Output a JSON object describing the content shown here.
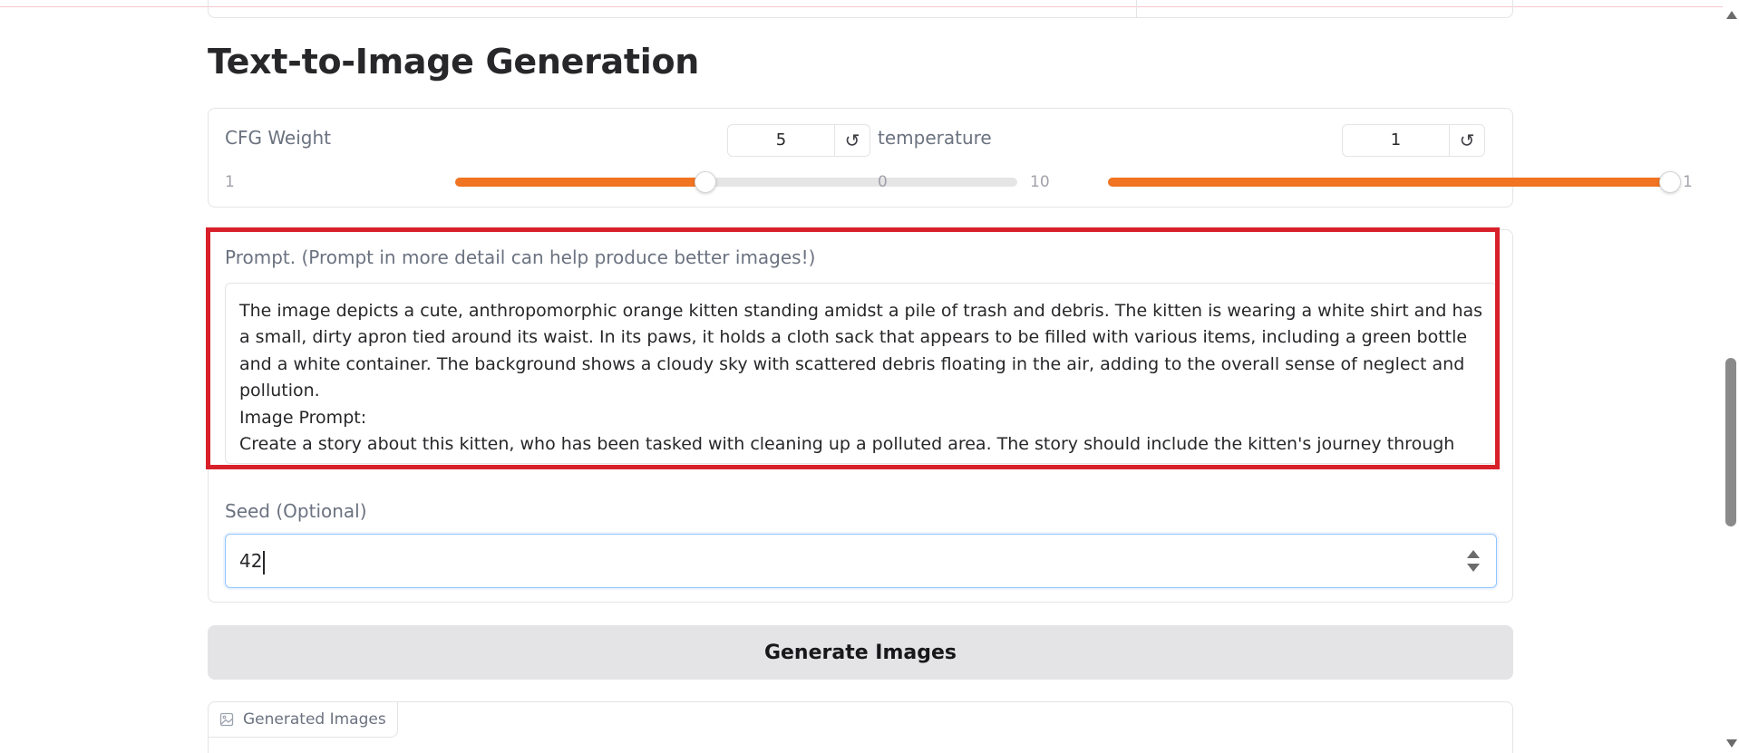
{
  "section": {
    "title": "Text-to-Image Generation"
  },
  "sliders": {
    "cfg": {
      "label": "CFG Weight",
      "value": "5",
      "min": "1",
      "max": "10",
      "fraction": 0.4444
    },
    "temperature": {
      "label": "temperature",
      "value": "1",
      "min": "0",
      "max": "1",
      "fraction": 1.0
    }
  },
  "reset_glyph": "↺",
  "prompt": {
    "label": "Prompt. (Prompt in more detail can help produce better images!)",
    "value": "The image depicts a cute, anthropomorphic orange kitten standing amidst a pile of trash and debris. The kitten is wearing a white shirt and has a small, dirty apron tied around its waist. In its paws, it holds a cloth sack that appears to be filled with various items, including a green bottle and a white container. The background shows a cloudy sky with scattered debris floating in the air, adding to the overall sense of neglect and pollution.\nImage Prompt:\nCreate a story about this kitten, who has been tasked with cleaning up a polluted area. The story should include the kitten's journey through the trash, its encounters with other creatures, and the lessons it learns about responsibility and the environment."
  },
  "seed": {
    "label": "Seed (Optional)",
    "value": "42"
  },
  "generate": {
    "label": "Generate Images"
  },
  "gallery": {
    "tab_label": "Generated Images"
  },
  "colors": {
    "accent": "#f07421",
    "highlight": "#d8202a",
    "button_bg": "#e4e4e7"
  }
}
